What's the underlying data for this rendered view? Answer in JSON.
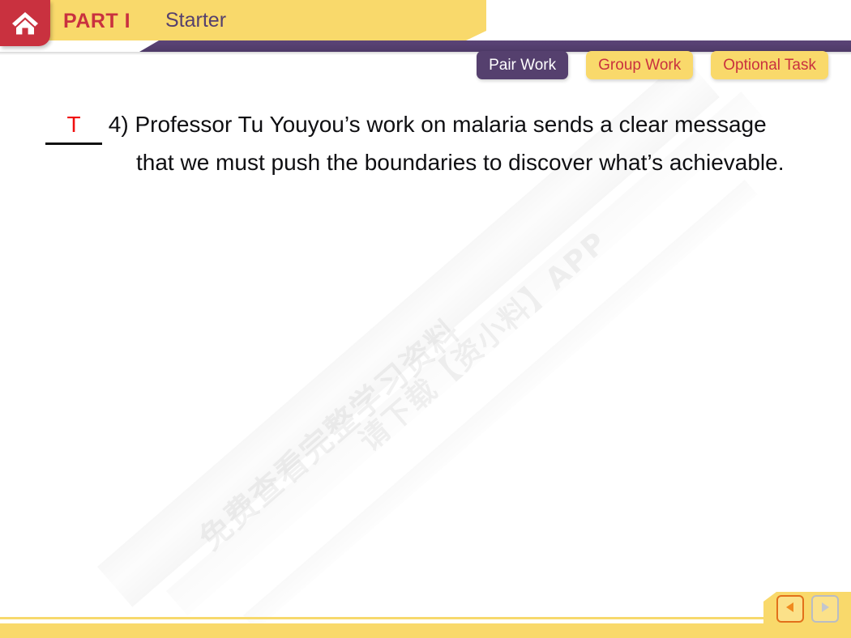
{
  "header": {
    "home_icon": "home-icon",
    "part_label": "PART I",
    "section_label": "Starter"
  },
  "tags": [
    {
      "id": "pair-work",
      "label": "Pair Work",
      "style": "pair",
      "bg": "#55406E",
      "fg": "#FFFFFF"
    },
    {
      "id": "group-work",
      "label": "Group Work",
      "style": "group",
      "bg": "#F9D96B",
      "fg": "#C9313F"
    },
    {
      "id": "optional-task",
      "label": "Optional Task",
      "style": "optional",
      "bg": "#F9D96B",
      "fg": "#C9313F"
    }
  ],
  "content": {
    "answer": "T",
    "number": "4)",
    "line1": "Professor Tu Youyou’s work on malaria sends a clear message",
    "line2": "that we must push the boundaries to discover what’s achievable."
  },
  "watermark": {
    "line1": "免费查看完整学习资料",
    "line2": "请下载【资小料】APP"
  },
  "navigation": {
    "prev_icon": "triangle-left-icon",
    "next_icon": "triangle-right-icon",
    "prev_state": "enabled",
    "next_state": "disabled"
  },
  "colors": {
    "yellow": "#F9D96B",
    "purple": "#55406E",
    "red": "#C9313F",
    "answer_red": "#F01010",
    "orange": "#E2701A",
    "gray": "#B9BCC4"
  }
}
